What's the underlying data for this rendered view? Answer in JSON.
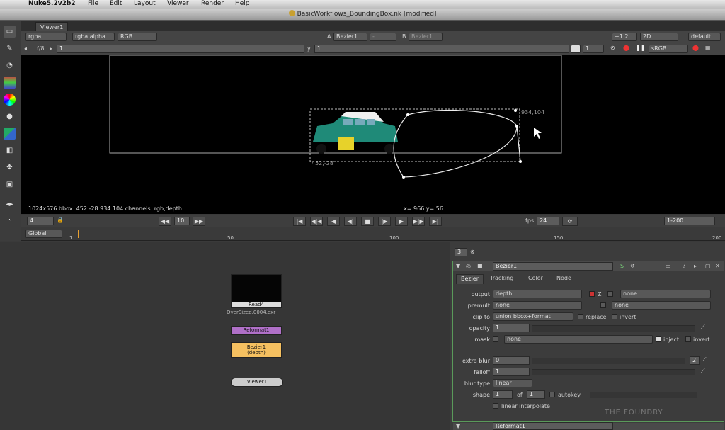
{
  "menubar": {
    "app_title": "Nuke5.2v2b2",
    "items": [
      "File",
      "Edit",
      "Layout",
      "Viewer",
      "Render",
      "Help"
    ]
  },
  "window": {
    "title": "BasicWorkflows_BoundingBox.nk [modified]"
  },
  "viewer": {
    "tab_label": "Viewer1",
    "channels": "rgba",
    "alpha": "rgba.alpha",
    "display": "RGB",
    "input_a_label": "A",
    "input_a": "Bezier1",
    "input_a_op": "-",
    "input_b_label": "B",
    "input_b": "Bezier1",
    "zoom": "+1.2",
    "view_mode": "2D",
    "lut_preset": "default",
    "gain_label": "f/8",
    "gain_value": "1",
    "gamma_label": "y",
    "gamma_value": "1",
    "proxy_value": "1",
    "colorspace": "sRGB",
    "status": "1024x576  bbox: 452 -28 934 104  channels: rgb,depth",
    "cursor_readout": "x= 966 y= 56",
    "bbox_label_tr": "934,104",
    "bbox_label_bl": "452,-28"
  },
  "transport": {
    "frame": "4",
    "step": "10",
    "fps_label": "fps",
    "fps": "24",
    "range": "1-200",
    "buttons": [
      "|◀",
      "◀|◀",
      "◀",
      "◀|",
      "■",
      "|▶",
      "▶",
      "▶|▶",
      "▶|"
    ]
  },
  "timeline": {
    "scope": "Global",
    "ticks": [
      "1",
      "50",
      "100",
      "150",
      "200"
    ]
  },
  "dag": {
    "read_node": "Read4",
    "read_file": "OverSized.0004.exr",
    "reformat_node": "Reformat1",
    "bezier_node": "Bezier1",
    "bezier_sub": "(depth)",
    "viewer_node": "Viewer1"
  },
  "properties": {
    "panel_count": "3",
    "node_name": "Bezier1",
    "tabs": [
      "Bezier",
      "Tracking",
      "Color",
      "Node"
    ],
    "output_label": "output",
    "output_value": "depth",
    "output_z": "Z",
    "output_extra": "none",
    "premult_label": "premult",
    "premult_value": "none",
    "premult_extra": "none",
    "clipto_label": "clip to",
    "clipto_value": "union bbox+format",
    "replace_label": "replace",
    "invert_label": "invert",
    "opacity_label": "opacity",
    "opacity_value": "1",
    "mask_label": "mask",
    "mask_value": "none",
    "inject_label": "inject",
    "mask_invert_label": "invert",
    "extrablur_label": "extra blur",
    "extrablur_value": "0",
    "extrablur_count": "2",
    "falloff_label": "falloff",
    "falloff_value": "1",
    "blurtype_label": "blur type",
    "blurtype_value": "linear",
    "shape_label": "shape",
    "shape_value": "1",
    "shape_of": "of",
    "shape_total": "1",
    "autokey_label": "autokey",
    "linear_interp_label": "linear interpolate",
    "next_panel": "Reformat1",
    "watermark": "THE FOUNDRY"
  },
  "colors": {
    "bezier_node": "#f5c060",
    "reformat_node": "#b070c8",
    "viewer_bg": "#000000",
    "accent_green": "#5a9a5a"
  }
}
